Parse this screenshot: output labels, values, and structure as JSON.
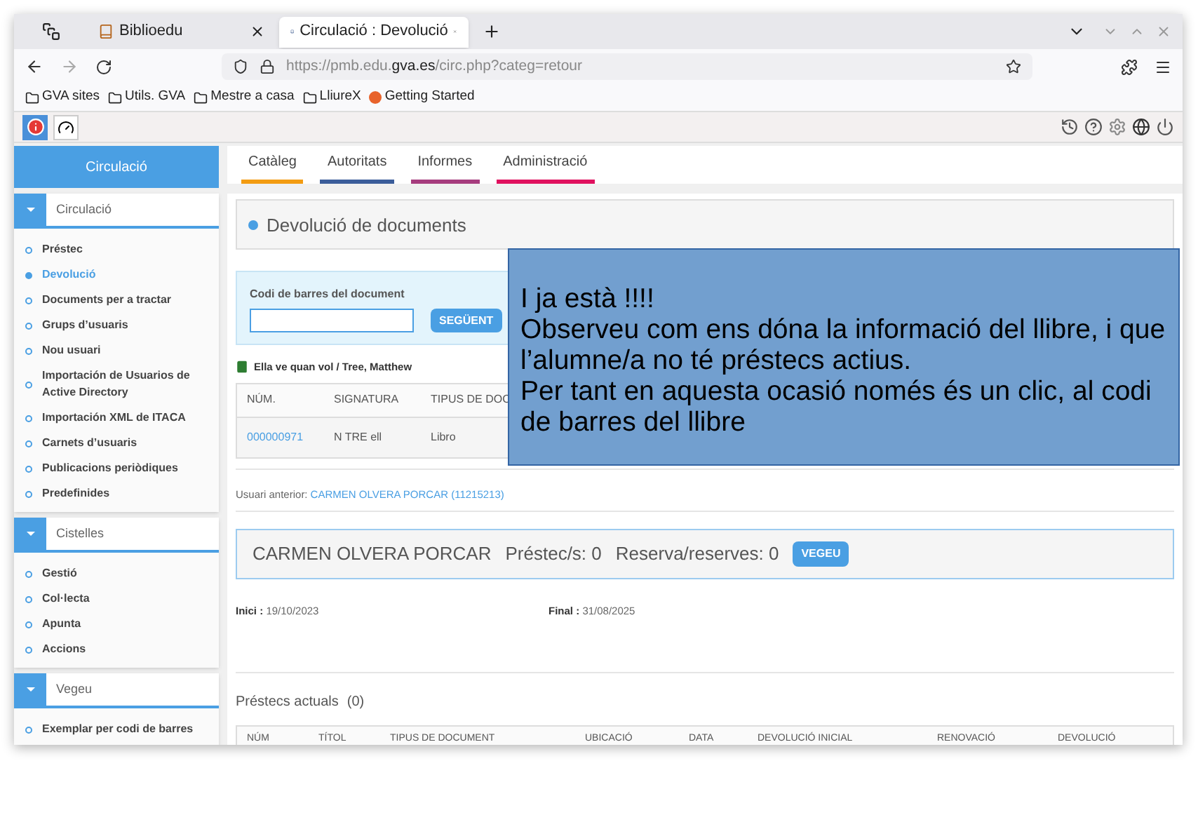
{
  "browser": {
    "tabs": [
      {
        "title": "Biblioedu",
        "selected": false
      },
      {
        "title": "Circulació : Devolució",
        "selected": true
      }
    ],
    "url": {
      "host_prefix": "https://pmb.edu.",
      "host": "gva.es",
      "path": "/circ.php?categ=retour"
    },
    "bookmarks": [
      {
        "label": "GVA sites",
        "kind": "folder"
      },
      {
        "label": "Utils. GVA",
        "kind": "folder"
      },
      {
        "label": "Mestre a casa",
        "kind": "folder"
      },
      {
        "label": "LliureX",
        "kind": "folder"
      },
      {
        "label": "Getting Started",
        "kind": "site"
      }
    ]
  },
  "sidebar": {
    "title": "Circulació",
    "sections": [
      {
        "title": "Circulació",
        "items": [
          {
            "label": "Préstec",
            "selected": false
          },
          {
            "label": "Devolució",
            "selected": true
          },
          {
            "label": "Documents per a tractar",
            "selected": false
          },
          {
            "label": "Grups d’usuaris",
            "selected": false
          },
          {
            "label": "Nou usuari",
            "selected": false
          },
          {
            "label": "Importación de Usuarios de Active Directory",
            "selected": false
          },
          {
            "label": "Importación XML de ITACA",
            "selected": false
          },
          {
            "label": "Carnets d’usuaris",
            "selected": false
          },
          {
            "label": "Publicacions periòdiques",
            "selected": false
          },
          {
            "label": "Predefinides",
            "selected": false
          }
        ]
      },
      {
        "title": "Cistelles",
        "items": [
          {
            "label": "Gestió",
            "selected": false
          },
          {
            "label": "Col·lecta",
            "selected": false
          },
          {
            "label": "Apunta",
            "selected": false
          },
          {
            "label": "Accions",
            "selected": false
          }
        ]
      },
      {
        "title": "Vegeu",
        "items": [
          {
            "label": "Exemplar per codi de barres",
            "selected": false
          }
        ]
      }
    ]
  },
  "menu_tabs": [
    {
      "label": "Catàleg",
      "color": "#f39c12"
    },
    {
      "label": "Autoritats",
      "color": "#3b5d9a"
    },
    {
      "label": "Informes",
      "color": "#a63c7e"
    },
    {
      "label": "Administració",
      "color": "#e0105e"
    }
  ],
  "page_title": "Devolució de documents",
  "barcode_form": {
    "label": "Codi de barres del document",
    "button": "SEGÜENT"
  },
  "document": {
    "title": "Ella ve quan vol / Tree, Matthew",
    "columns": [
      "NÚM.",
      "SIGNATURA",
      "TIPUS DE DOC"
    ],
    "rows": [
      [
        "000000971",
        "N TRE ell",
        "Libro"
      ]
    ]
  },
  "previous_user": {
    "label": "Usuari anterior:",
    "link": "CARMEN OLVERA PORCAR (11215213)"
  },
  "user": {
    "name": "CARMEN OLVERA PORCAR",
    "loans": "Préstec/s: 0",
    "reservations": "Reserva/reserves: 0",
    "button": "VEGEU"
  },
  "dates": [
    {
      "label": "Inici :",
      "value": "19/10/2023"
    },
    {
      "label": "Final :",
      "value": "31/08/2025"
    }
  ],
  "current_loans": {
    "title": "Préstecs actuals",
    "count": "(0)",
    "columns": [
      "NÚM",
      "TÍTOL",
      "TIPUS DE DOCUMENT",
      "UBICACIÓ",
      "DATA",
      "DEVOLUCIÓ INICIAL",
      "RENOVACIÓ",
      "DEVOLUCIÓ"
    ]
  },
  "callout": [
    "I ja està !!!!",
    "Observeu com ens dóna la informació del llibre, i que l’alumne/a no té préstecs actius.",
    "Per tant en aquesta ocasió només és un clic, al codi de barres del llibre"
  ]
}
